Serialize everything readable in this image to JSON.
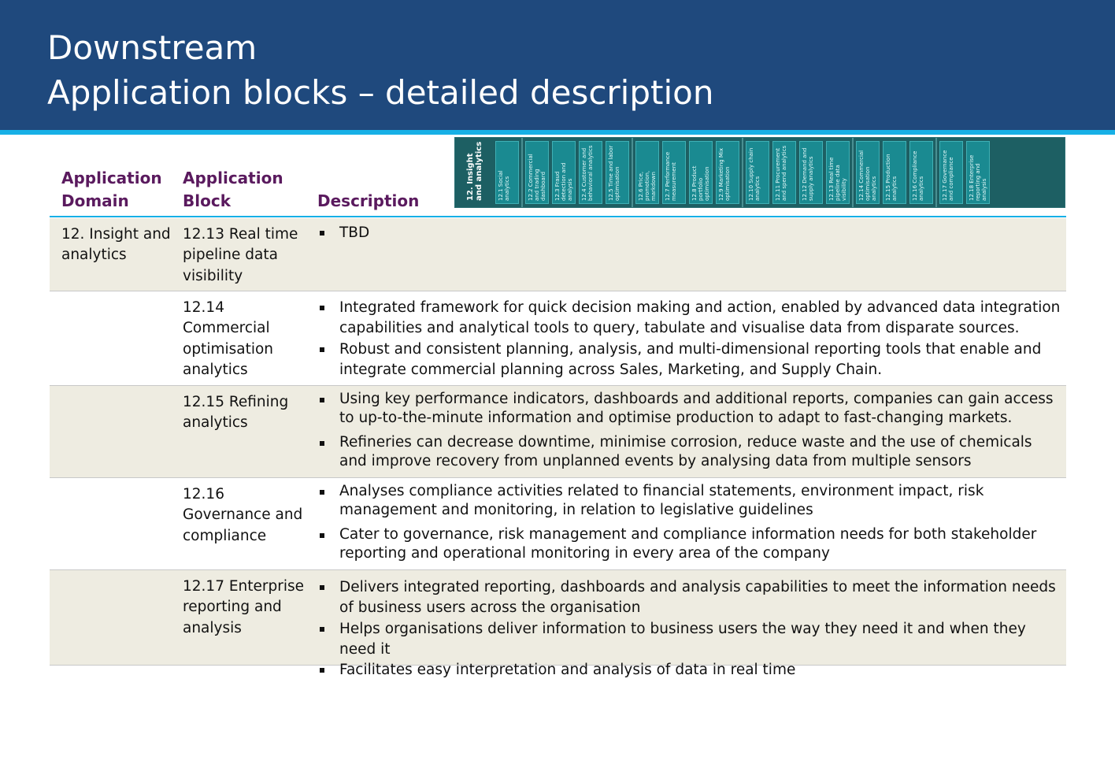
{
  "header": {
    "title_line1": "Downstream",
    "title_line2": "Application blocks – detailed description",
    "background": "#1f497d",
    "stripe": "#17b0e6"
  },
  "columns": {
    "domain": "Application Domain",
    "block": "Application Block",
    "description": "Description",
    "heading_color": "#5a1a5e"
  },
  "thumbnail": {
    "domain_label": "12. Insight and analytics",
    "groups": [
      [
        "12.1 Social analytics"
      ],
      [
        "12.2 Commercial and trading dashboard",
        "12.3 Fraud detection and analysis",
        "12.4 Customer and behavioral analytics",
        "12.5 Time and labor optimisation"
      ],
      [
        "12.6 Price, promotion, markdown optimisation",
        "12.7 Performance measurement",
        "12.8 Product portfolio optimisation",
        "12.9 Marketing Mix optimisation"
      ],
      [
        "12.10 Supply chain analytics",
        "12.11 Procurement and spend analytics",
        "12.12 Demand and supply analytics",
        "12.13 Real time pipeline data visibility"
      ],
      [
        "12.14 Commercial optimisation analytics",
        "12.15 Production analytics",
        "12.16 Compliance analytics"
      ],
      [
        "12.17 Governance and compliance",
        "12.18 Enterprise reporting and analysis"
      ]
    ]
  },
  "rows": [
    {
      "domain": "12. Insight and analytics",
      "block": "12.13 Real time pipeline data visibility",
      "bullets": [
        "TBD"
      ]
    },
    {
      "domain": "",
      "block": "12.14 Commercial optimisation analytics",
      "bullets": [
        "Integrated framework for quick decision making and action, enabled by advanced data integration capabilities and analytical tools to query, tabulate and visualise data from disparate sources.",
        "Robust and consistent planning, analysis, and multi-dimensional reporting tools that enable and integrate commercial planning across Sales, Marketing, and Supply Chain."
      ]
    },
    {
      "domain": "",
      "block": "12.15 Refining analytics",
      "bullets": [
        "Using key performance indicators, dashboards and additional reports, companies can gain access to up-to-the-minute information and optimise production to adapt to fast-changing markets.",
        "Refineries can decrease downtime, minimise corrosion, reduce waste and the use of chemicals and improve recovery from unplanned events by analysing data from multiple sensors"
      ]
    },
    {
      "domain": "",
      "block": "12.16 Governance and compliance",
      "bullets": [
        "Analyses compliance activities related to financial statements, environment impact, risk management and monitoring, in relation to legislative guidelines",
        "Cater to governance, risk management and compliance information needs for both stakeholder reporting and operational monitoring in every area of the company"
      ]
    },
    {
      "domain": "",
      "block": "12.17 Enterprise reporting and analysis",
      "bullets": [
        "Delivers integrated reporting, dashboards and analysis capabilities to meet the information needs of business users across the organisation",
        "Helps organisations deliver information to business users the way they need it and when they need it",
        "Facilitates easy interpretation and analysis of data in real time"
      ]
    }
  ]
}
